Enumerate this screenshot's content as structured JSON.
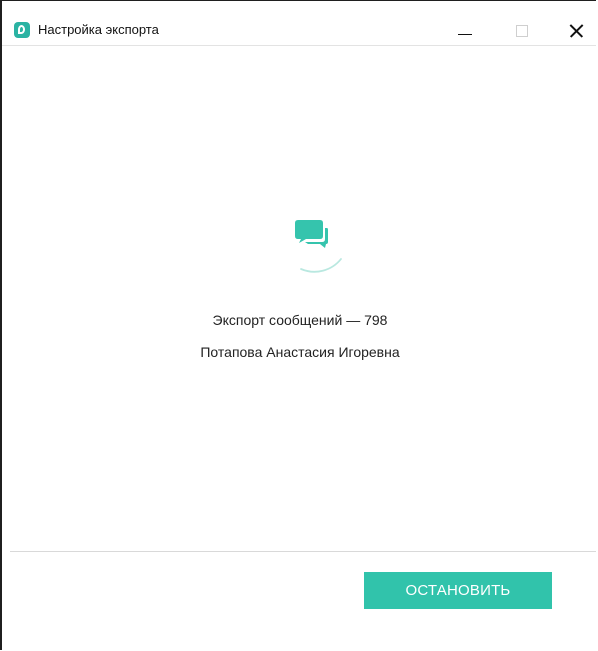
{
  "window": {
    "title": "Настройка экспорта",
    "accent_color": "#31c3ab"
  },
  "icons": {
    "app": "app-logo-icon",
    "loader": "chat-bubbles-icon",
    "minimize": "minimize-icon",
    "maximize": "maximize-icon",
    "close": "close-icon"
  },
  "export": {
    "status_text": "Экспорт сообщений — 798",
    "contact_name": "Потапова  Анастасия Игоревна"
  },
  "actions": {
    "stop_label": "ОСТАНОВИТЬ"
  }
}
